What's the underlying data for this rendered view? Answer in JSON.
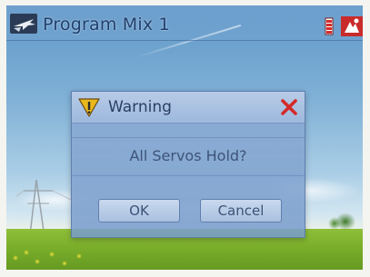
{
  "window": {
    "title": "Program Mix 1",
    "app_icon": "airplane-icon",
    "status_icons": [
      "battery-icon",
      "system-icon"
    ]
  },
  "dialog": {
    "title": "Warning",
    "title_icon": "warning-icon",
    "close_icon": "close-icon",
    "message": "All Servos Hold?",
    "ok_label": "OK",
    "cancel_label": "Cancel"
  },
  "colors": {
    "title_text": "#1f3f6e",
    "dialog_text": "#3e5478",
    "close_red": "#d42a2a",
    "warning_yellow": "#e8b81c"
  }
}
